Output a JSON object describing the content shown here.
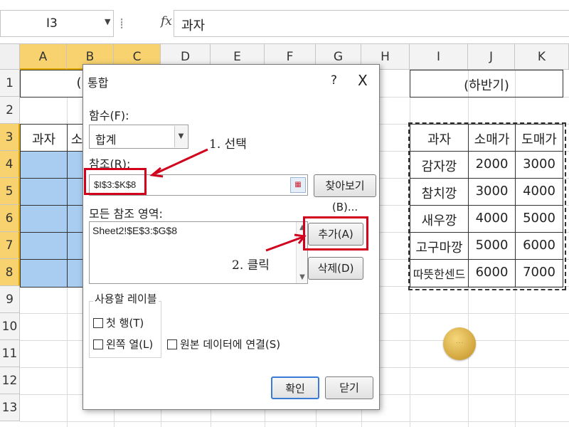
{
  "formula_bar": {
    "name_box": "I3",
    "fx_label": "fx",
    "content": "과자"
  },
  "columns": [
    "A",
    "B",
    "C",
    "D",
    "E",
    "F",
    "G",
    "H",
    "I",
    "J",
    "K"
  ],
  "rows": [
    "1",
    "2",
    "3",
    "4",
    "5",
    "6",
    "7",
    "8",
    "9",
    "10",
    "11",
    "12",
    "13"
  ],
  "sheet": {
    "b1_partial": "(",
    "a3": "과자",
    "b3_partial": "소",
    "i1": "(하반기)",
    "table_header": [
      "과자",
      "소매가",
      "도매가"
    ],
    "table_rows": [
      [
        "감자깡",
        "2000",
        "3000"
      ],
      [
        "참치깡",
        "3000",
        "4000"
      ],
      [
        "새우깡",
        "4000",
        "5000"
      ],
      [
        "고구마깡",
        "5000",
        "6000"
      ],
      [
        "따뜻한센드",
        "6000",
        "7000"
      ]
    ]
  },
  "dialog": {
    "title": "통합",
    "help": "?",
    "close": "X",
    "function_label": "함수(F):",
    "function_value": "합계",
    "reference_label": "참조(R):",
    "reference_value": "$I$3:$K$8",
    "browse_button": "찾아보기(B)...",
    "all_refs_label": "모든 참조 영역:",
    "all_refs_value": "Sheet2!$E$3:$G$8",
    "add_button": "추가(A)",
    "delete_button": "삭제(D)",
    "use_labels_title": "사용할 레이블",
    "top_row": "첫 행(T)",
    "left_column": "왼쪽 열(L)",
    "link_source": "원본 데이터에 연결(S)",
    "ok_button": "확인",
    "close_button": "닫기"
  },
  "annotations": {
    "step1": "1. 선택",
    "step2": "2. 클릭"
  },
  "colors": {
    "selected_header": "#f7d26f",
    "blue_fill": "#a9cdf0",
    "highlight_red": "#d1001c"
  },
  "icons": {
    "namebox_dropdown": "chevron-down-icon",
    "range_picker": "range-select-icon"
  }
}
